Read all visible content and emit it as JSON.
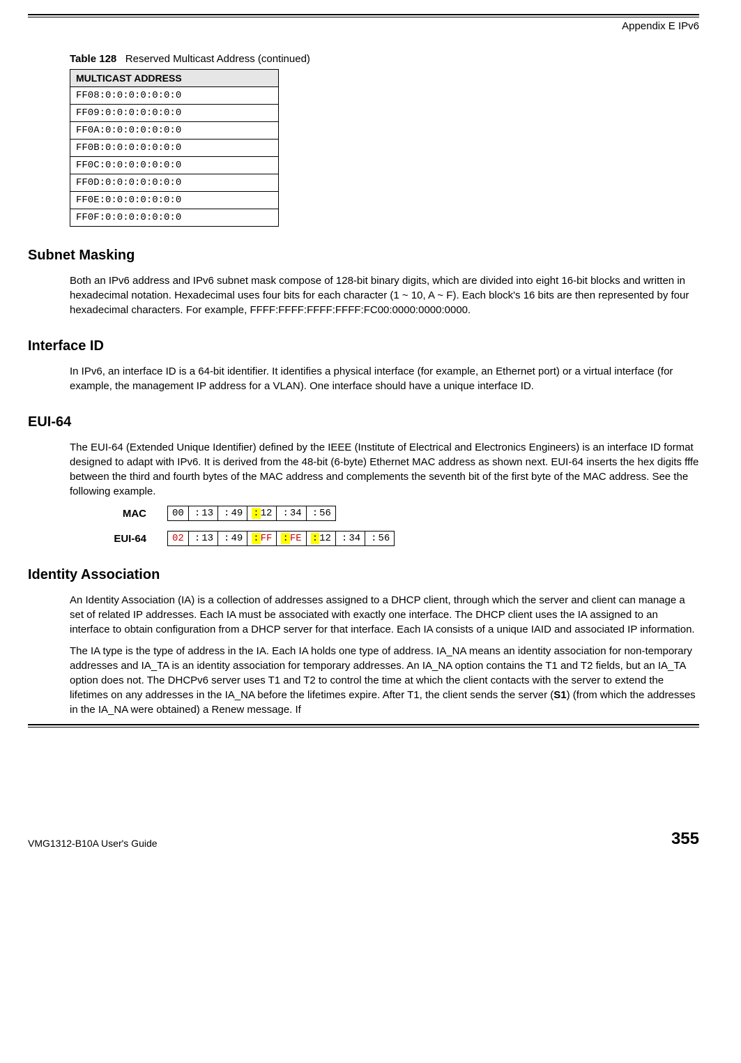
{
  "header": {
    "appendix": "Appendix E IPv6"
  },
  "table": {
    "caption_label": "Table 128",
    "caption_text": "Reserved Multicast Address (continued)",
    "header": "MULTICAST ADDRESS",
    "rows": [
      "FF08:0:0:0:0:0:0:0",
      "FF09:0:0:0:0:0:0:0",
      "FF0A:0:0:0:0:0:0:0",
      "FF0B:0:0:0:0:0:0:0",
      "FF0C:0:0:0:0:0:0:0",
      "FF0D:0:0:0:0:0:0:0",
      "FF0E:0:0:0:0:0:0:0",
      "FF0F:0:0:0:0:0:0:0"
    ]
  },
  "sections": {
    "subnet_masking": {
      "title": "Subnet Masking",
      "body": "Both an IPv6 address and IPv6 subnet mask compose of 128-bit binary digits, which are divided into eight 16-bit blocks and written in hexadecimal notation. Hexadecimal uses four bits for each character (1 ~ 10, A ~ F). Each block's 16 bits are then represented by four hexadecimal characters. For example, FFFF:FFFF:FFFF:FFFF:FC00:0000:0000:0000."
    },
    "interface_id": {
      "title": "Interface ID",
      "body": "In IPv6, an interface ID is a 64-bit identifier. It identifies a physical interface (for example, an Ethernet port) or a virtual interface (for example, the management IP address for a VLAN). One interface should have a unique interface ID."
    },
    "eui64": {
      "title": "EUI-64",
      "body": "The EUI-64 (Extended Unique Identifier) defined by the IEEE (Institute of Electrical and Electronics Engineers) is an interface ID format designed to adapt with IPv6. It is derived from the 48-bit (6-byte) Ethernet MAC address as shown next. EUI-64 inserts the hex digits fffe between the third and fourth bytes of the MAC address and complements the seventh bit of the first byte of the MAC address. See the following example."
    },
    "identity_association": {
      "title": "Identity Association",
      "body1": "An Identity Association (IA) is a collection of addresses assigned to a DHCP client, through which the server and client can manage a set of related IP addresses. Each IA must be associated with exactly one interface. The DHCP client uses the IA assigned to an interface to obtain configuration from a DHCP server for that interface. Each IA consists of a unique IAID and associated IP information.",
      "body2_pre": "The IA type is the type of address in the IA. Each IA holds one type of address. IA_NA means an identity association for non-temporary addresses and IA_TA is an identity association for temporary addresses. An IA_NA option contains the T1 and T2 fields, but an IA_TA option does not. The DHCPv6 server uses T1 and T2 to control the time at which the client contacts with the server to extend the lifetimes on any addresses in the IA_NA before the lifetimes expire. After T1, the client sends the server (",
      "body2_bold": "S1",
      "body2_post": ") (from which the addresses in the IA_NA were obtained) a Renew message. If"
    }
  },
  "eui": {
    "mac_label": "MAC",
    "eui_label": "EUI-64",
    "mac": [
      "00",
      "13",
      "49",
      "12",
      "34",
      "56"
    ],
    "eui64": [
      "02",
      "13",
      "49",
      "FF",
      "FE",
      "12",
      "34",
      "56"
    ]
  },
  "footer": {
    "guide": "VMG1312-B10A User's Guide",
    "page": "355"
  }
}
